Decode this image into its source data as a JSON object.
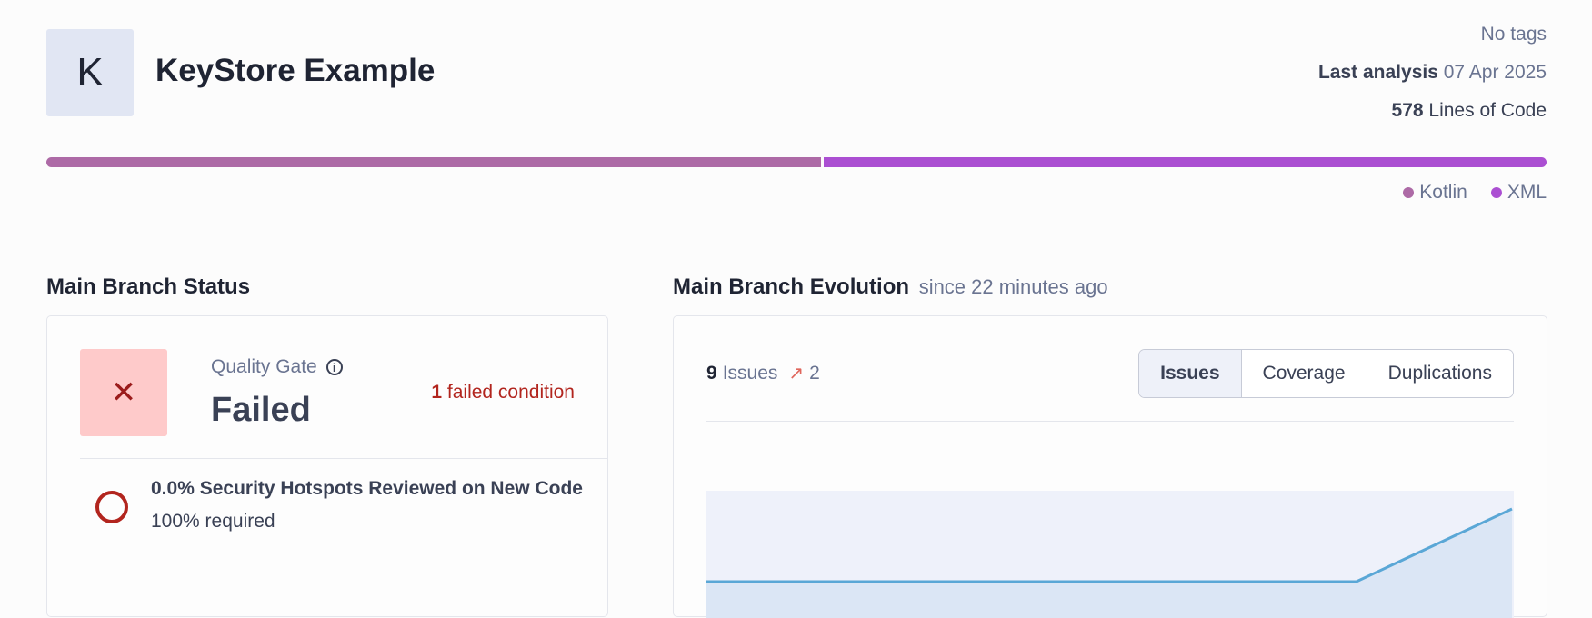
{
  "project": {
    "avatar_letter": "K",
    "title": "KeyStore Example"
  },
  "meta": {
    "tags": "No tags",
    "last_analysis_label": "Last analysis",
    "last_analysis_date": "07 Apr 2025",
    "loc_value": "578",
    "loc_label": "Lines of Code"
  },
  "languages": [
    {
      "name": "Kotlin",
      "color": "#ad6aa6",
      "share": 0.517
    },
    {
      "name": "XML",
      "color": "#ab4fd2",
      "share": 0.483
    }
  ],
  "status": {
    "section_title": "Main Branch Status",
    "quality_gate_label": "Quality Gate",
    "quality_gate_status": "Failed",
    "status_icon": "close-icon",
    "failed_count": "1",
    "failed_label": "failed condition",
    "condition": {
      "title": "0.0% Security Hotspots Reviewed on New Code",
      "requirement": "100% required"
    }
  },
  "evolution": {
    "section_title": "Main Branch Evolution",
    "since": "since 22 minutes ago",
    "issues_count": "9",
    "issues_label": "Issues",
    "trend_value": "2",
    "trend_icon": "arrow-up-right-icon",
    "tabs": [
      "Issues",
      "Coverage",
      "Duplications"
    ],
    "active_tab": "Issues"
  },
  "chart_data": {
    "type": "area",
    "series": [
      {
        "values": [
          7,
          7,
          7,
          7,
          7,
          9
        ]
      }
    ],
    "ylim": [
      6,
      9.5
    ],
    "grid": false,
    "line_color": "#5aa7d6",
    "fill_color": "#dbe6f5",
    "plot_bg": "#eef1fa"
  }
}
